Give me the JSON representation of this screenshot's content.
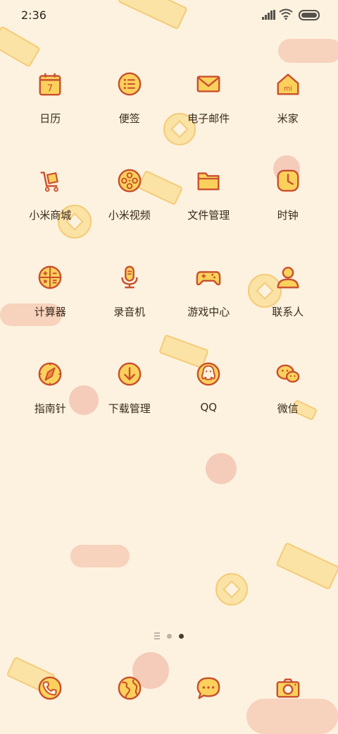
{
  "status_bar": {
    "time": "2:36"
  },
  "apps": [
    {
      "label": "日历",
      "icon": "calendar-icon",
      "icon_text": "7"
    },
    {
      "label": "便签",
      "icon": "notes-icon"
    },
    {
      "label": "电子邮件",
      "icon": "mail-icon"
    },
    {
      "label": "米家",
      "icon": "mi-home-icon",
      "icon_text": "mi"
    },
    {
      "label": "小米商城",
      "icon": "shopping-cart-icon"
    },
    {
      "label": "小米视频",
      "icon": "film-reel-icon"
    },
    {
      "label": "文件管理",
      "icon": "folder-icon"
    },
    {
      "label": "时钟",
      "icon": "clock-icon"
    },
    {
      "label": "计算器",
      "icon": "calculator-icon"
    },
    {
      "label": "录音机",
      "icon": "microphone-icon"
    },
    {
      "label": "游戏中心",
      "icon": "gamepad-icon"
    },
    {
      "label": "联系人",
      "icon": "contact-icon"
    },
    {
      "label": "指南针",
      "icon": "compass-icon"
    },
    {
      "label": "下载管理",
      "icon": "download-icon"
    },
    {
      "label": "QQ",
      "icon": "qq-penguin-icon"
    },
    {
      "label": "微信",
      "icon": "wechat-icon"
    }
  ],
  "page_indicator": {
    "pages": 3,
    "active": 2
  },
  "dock": [
    {
      "icon": "phone-icon"
    },
    {
      "icon": "browser-globe-icon"
    },
    {
      "icon": "messages-icon"
    },
    {
      "icon": "camera-icon"
    }
  ],
  "colors": {
    "background": "#fdf2df",
    "icon_fill": "#fbd15b",
    "icon_stroke": "#c94f2e"
  }
}
